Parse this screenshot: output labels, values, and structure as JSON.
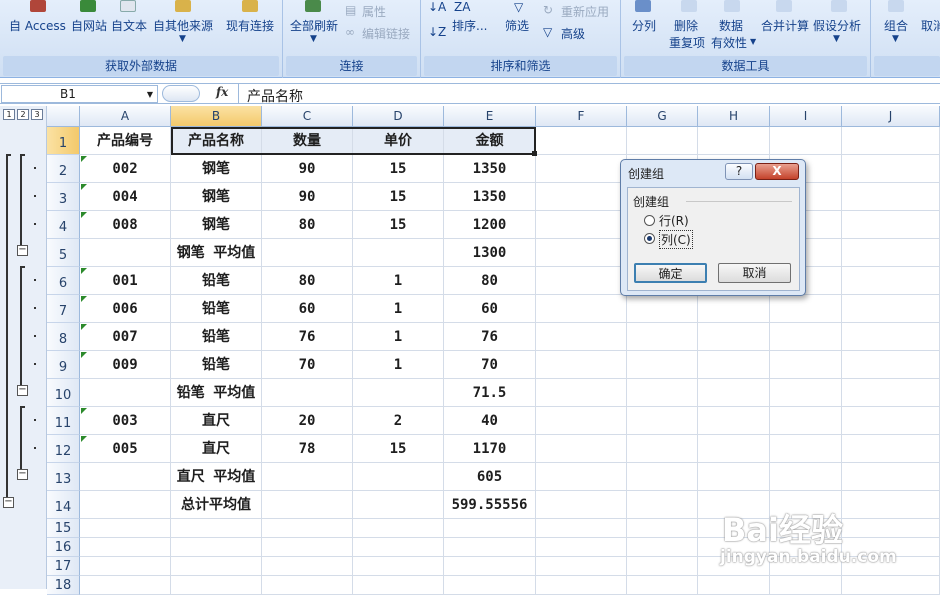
{
  "ribbon": {
    "get_external": {
      "access": "自 Access",
      "web": "自网站",
      "text": "自文本",
      "other": "自其他来源",
      "existing": "现有连接",
      "label": "获取外部数据"
    },
    "connections": {
      "refresh_all": "全部刷新",
      "properties": "属性",
      "edit_links": "编辑链接",
      "label": "连接"
    },
    "sort_filter": {
      "sort": "排序...",
      "filter": "筛选",
      "reapply": "重新应用",
      "advanced": "高级",
      "label": "排序和筛选"
    },
    "data_tools": {
      "split": "分列",
      "remove_dup_1": "删除",
      "remove_dup_2": "重复项",
      "validation_1": "数据",
      "validation_2": "有效性",
      "consolidate": "合并计算",
      "what_if": "假设分析",
      "label": "数据工具"
    },
    "outline": {
      "group": "组合",
      "ungroup": "取消"
    }
  },
  "formula_bar": {
    "name_box": "B1",
    "fx": "fx",
    "value": "产品名称"
  },
  "outline_levels": [
    "1",
    "2",
    "3"
  ],
  "columns": [
    "A",
    "B",
    "C",
    "D",
    "E",
    "F",
    "G",
    "H",
    "I",
    "J"
  ],
  "rows": [
    {
      "n": "1",
      "a": "产品编号",
      "b": "产品名称",
      "c": "数量",
      "d": "单价",
      "e": "金额"
    },
    {
      "n": "2",
      "a": "002",
      "b": "钢笔",
      "c": "90",
      "d": "15",
      "e": "1350"
    },
    {
      "n": "3",
      "a": "004",
      "b": "钢笔",
      "c": "90",
      "d": "15",
      "e": "1350"
    },
    {
      "n": "4",
      "a": "008",
      "b": "钢笔",
      "c": "80",
      "d": "15",
      "e": "1200"
    },
    {
      "n": "5",
      "a": "",
      "b": "钢笔 平均值",
      "c": "",
      "d": "",
      "e": "1300"
    },
    {
      "n": "6",
      "a": "001",
      "b": "铅笔",
      "c": "80",
      "d": "1",
      "e": "80"
    },
    {
      "n": "7",
      "a": "006",
      "b": "铅笔",
      "c": "60",
      "d": "1",
      "e": "60"
    },
    {
      "n": "8",
      "a": "007",
      "b": "铅笔",
      "c": "76",
      "d": "1",
      "e": "76"
    },
    {
      "n": "9",
      "a": "009",
      "b": "铅笔",
      "c": "70",
      "d": "1",
      "e": "70"
    },
    {
      "n": "10",
      "a": "",
      "b": "铅笔 平均值",
      "c": "",
      "d": "",
      "e": "71.5"
    },
    {
      "n": "11",
      "a": "003",
      "b": "直尺",
      "c": "20",
      "d": "2",
      "e": "40"
    },
    {
      "n": "12",
      "a": "005",
      "b": "直尺",
      "c": "78",
      "d": "15",
      "e": "1170"
    },
    {
      "n": "13",
      "a": "",
      "b": "直尺 平均值",
      "c": "",
      "d": "",
      "e": "605"
    },
    {
      "n": "14",
      "a": "",
      "b": "总计平均值",
      "c": "",
      "d": "",
      "e": "599.55556"
    },
    {
      "n": "15",
      "a": "",
      "b": "",
      "c": "",
      "d": "",
      "e": ""
    },
    {
      "n": "16",
      "a": "",
      "b": "",
      "c": "",
      "d": "",
      "e": ""
    },
    {
      "n": "17",
      "a": "",
      "b": "",
      "c": "",
      "d": "",
      "e": ""
    },
    {
      "n": "18",
      "a": "",
      "b": "",
      "c": "",
      "d": "",
      "e": ""
    }
  ],
  "dialog": {
    "title": "创建组",
    "help": "?",
    "close": "X",
    "group_label": "创建组",
    "row_option": "行(R)",
    "col_option": "列(C)",
    "selected": "col",
    "ok": "确定",
    "cancel": "取消"
  },
  "watermark": {
    "brand": "Bai经验",
    "url": "jingyan.baidu.com"
  },
  "colors": {
    "ribbon_text": "#15428b",
    "selected_header": "#f3c96b"
  }
}
